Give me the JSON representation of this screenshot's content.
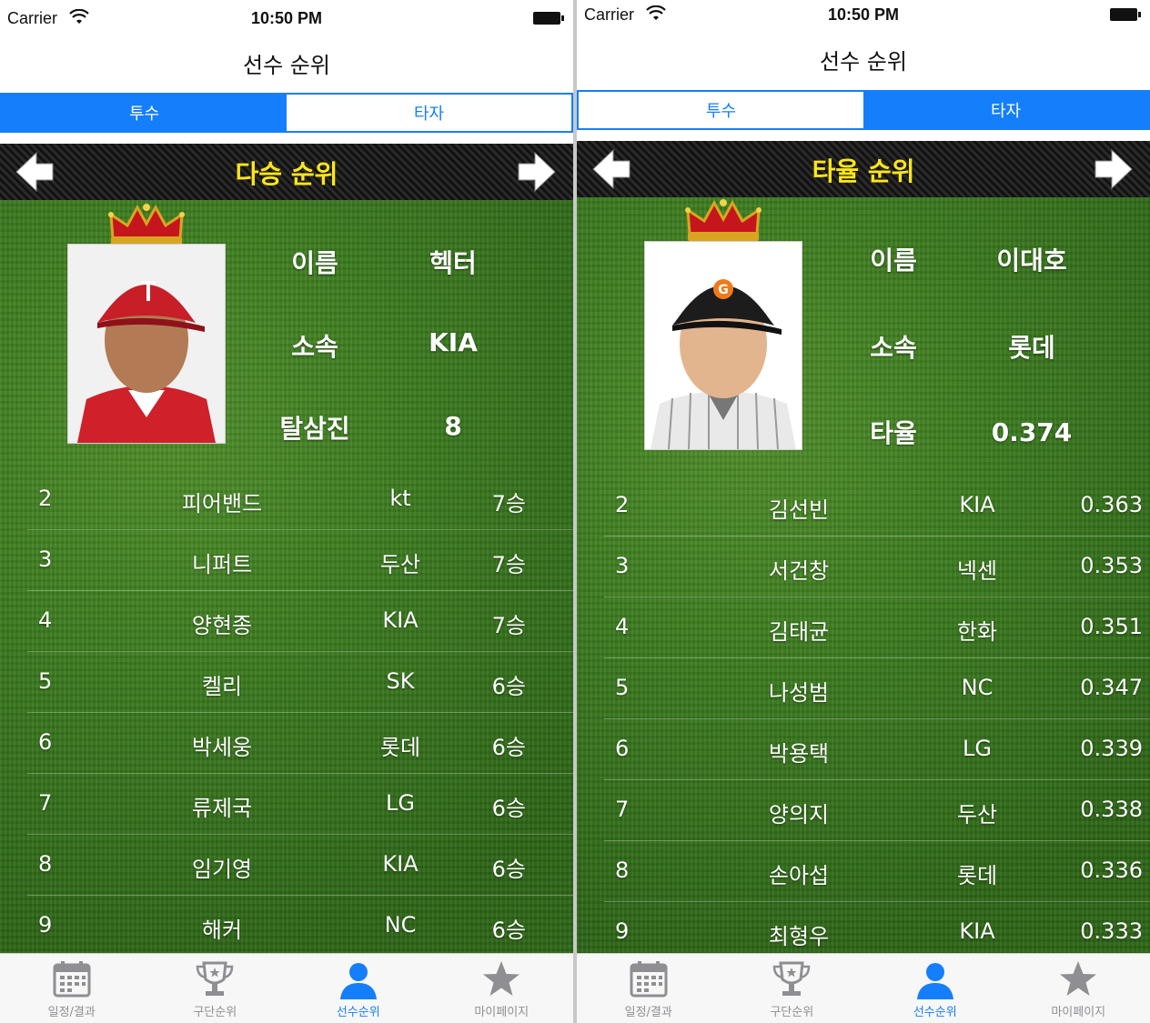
{
  "screens": [
    {
      "status": {
        "carrier": "Carrier",
        "time": "10:50 PM"
      },
      "nav_title": "선수 순위",
      "segments": [
        {
          "label": "투수"
        },
        {
          "label": "타자"
        }
      ],
      "active_segment": 0,
      "header_title": "다승 순위",
      "top_player": {
        "name_label": "이름",
        "name": "헥터",
        "team_label": "소속",
        "team": "KIA",
        "stat_label": "탈삼진",
        "stat": "8"
      },
      "rows": [
        {
          "rank": "2",
          "name": "피어밴드",
          "team": "kt",
          "stat": "7승"
        },
        {
          "rank": "3",
          "name": "니퍼트",
          "team": "두산",
          "stat": "7승"
        },
        {
          "rank": "4",
          "name": "양현종",
          "team": "KIA",
          "stat": "7승"
        },
        {
          "rank": "5",
          "name": "켈리",
          "team": "SK",
          "stat": "6승"
        },
        {
          "rank": "6",
          "name": "박세웅",
          "team": "롯데",
          "stat": "6승"
        },
        {
          "rank": "7",
          "name": "류제국",
          "team": "LG",
          "stat": "6승"
        },
        {
          "rank": "8",
          "name": "임기영",
          "team": "KIA",
          "stat": "6승"
        },
        {
          "rank": "9",
          "name": "해커",
          "team": "NC",
          "stat": "6승"
        }
      ],
      "tabs": [
        {
          "label": "일정/결과",
          "icon": "calendar-icon"
        },
        {
          "label": "구단순위",
          "icon": "trophy-icon"
        },
        {
          "label": "선수순위",
          "icon": "person-icon"
        },
        {
          "label": "마이페이지",
          "icon": "star-icon"
        }
      ],
      "active_tab": 2
    },
    {
      "status": {
        "carrier": "Carrier",
        "time": "10:50 PM"
      },
      "nav_title": "선수 순위",
      "segments": [
        {
          "label": "투수"
        },
        {
          "label": "타자"
        }
      ],
      "active_segment": 1,
      "header_title": "타율 순위",
      "top_player": {
        "name_label": "이름",
        "name": "이대호",
        "team_label": "소속",
        "team": "롯데",
        "stat_label": "타율",
        "stat": "0.374"
      },
      "rows": [
        {
          "rank": "2",
          "name": "김선빈",
          "team": "KIA",
          "stat": "0.363"
        },
        {
          "rank": "3",
          "name": "서건창",
          "team": "넥센",
          "stat": "0.353"
        },
        {
          "rank": "4",
          "name": "김태균",
          "team": "한화",
          "stat": "0.351"
        },
        {
          "rank": "5",
          "name": "나성범",
          "team": "NC",
          "stat": "0.347"
        },
        {
          "rank": "6",
          "name": "박용택",
          "team": "LG",
          "stat": "0.339"
        },
        {
          "rank": "7",
          "name": "양의지",
          "team": "두산",
          "stat": "0.338"
        },
        {
          "rank": "8",
          "name": "손아섭",
          "team": "롯데",
          "stat": "0.336"
        },
        {
          "rank": "9",
          "name": "최형우",
          "team": "KIA",
          "stat": "0.333"
        }
      ],
      "tabs": [
        {
          "label": "일정/결과",
          "icon": "calendar-icon"
        },
        {
          "label": "구단순위",
          "icon": "trophy-icon"
        },
        {
          "label": "선수순위",
          "icon": "person-icon"
        },
        {
          "label": "마이페이지",
          "icon": "star-icon"
        }
      ],
      "active_tab": 2
    }
  ],
  "colors": {
    "accent": "#157efb",
    "header_text": "#ffe61a",
    "header_bg": "#1a1a1a",
    "grass": "#3a7a1e"
  }
}
